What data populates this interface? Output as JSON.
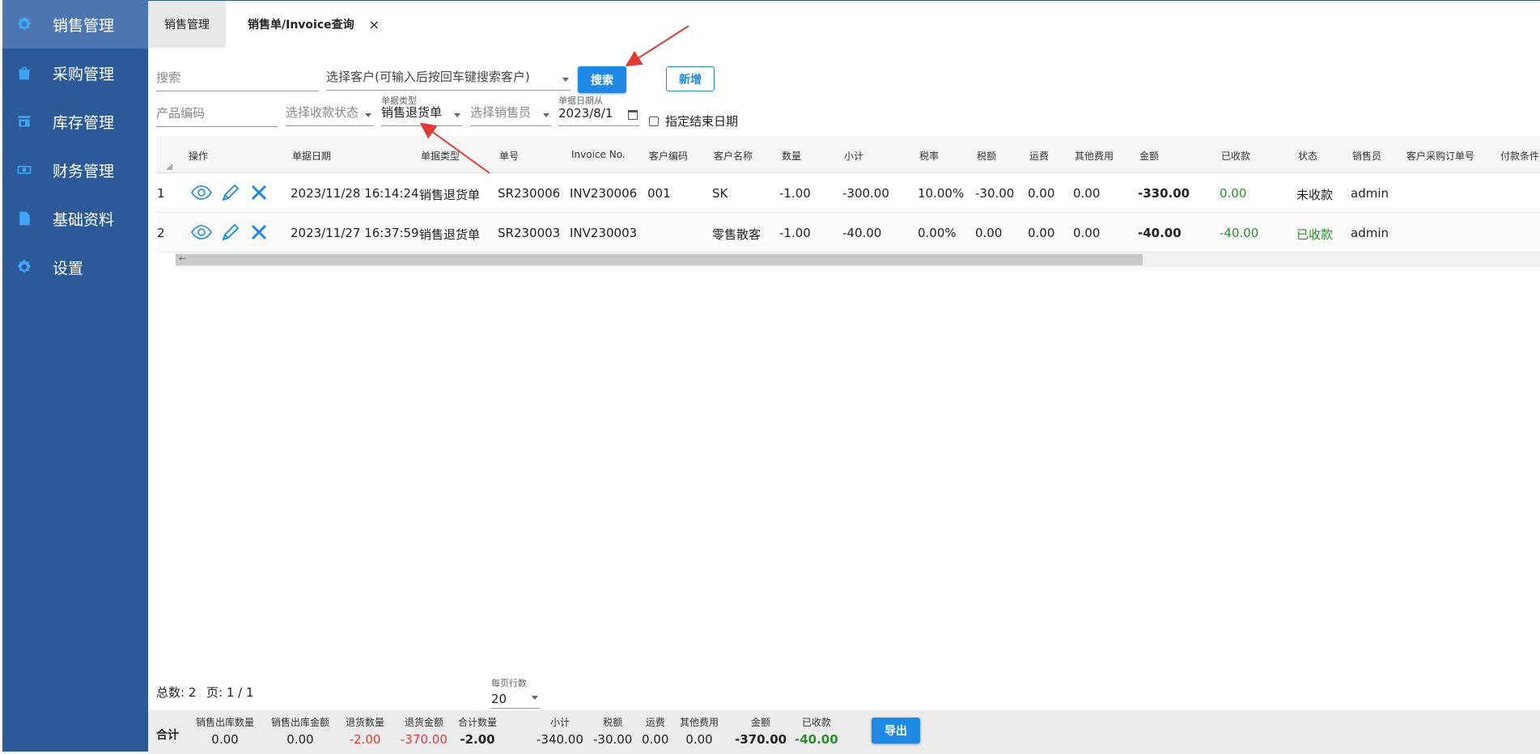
{
  "sidebar": {
    "items": [
      {
        "label": "销售管理",
        "icon": "gear-icon",
        "active": true
      },
      {
        "label": "采购管理",
        "icon": "shopping-bag-icon"
      },
      {
        "label": "库存管理",
        "icon": "store-icon"
      },
      {
        "label": "财务管理",
        "icon": "money-icon"
      },
      {
        "label": "基础资料",
        "icon": "document-icon"
      },
      {
        "label": "设置",
        "icon": "settings-icon"
      }
    ]
  },
  "tabs": [
    {
      "label": "销售管理"
    },
    {
      "label": "销售单/Invoice查询",
      "close": "×"
    }
  ],
  "filters": {
    "search_placeholder": "搜索",
    "customer_placeholder": "选择客户(可输入后按回车键搜索客户)",
    "search_button": "搜索",
    "add_button": "新增",
    "product_code_placeholder": "产品编码",
    "payment_status_placeholder": "选择收款状态",
    "doc_type_label": "单据类型",
    "doc_type_value": "销售退货单",
    "salesperson_placeholder": "选择销售员",
    "date_from_label": "单据日期从",
    "date_from_value": "2023/8/1",
    "end_date_checkbox": "指定结束日期"
  },
  "table": {
    "headers": [
      "操作",
      "单据日期",
      "单据类型",
      "单号",
      "Invoice No.",
      "客户编码",
      "客户名称",
      "数量",
      "小计",
      "税率",
      "税额",
      "运费",
      "其他费用",
      "金额",
      "已收款",
      "状态",
      "销售员",
      "客户采购订单号",
      "付款条件"
    ],
    "rows": [
      {
        "idx": "1",
        "date": "2023/11/28 16:14:24",
        "type": "销售退货单",
        "no": "SR230006",
        "invoice": "INV230006",
        "cust_code": "001",
        "cust_name": "SK",
        "qty": "-1.00",
        "subtotal": "-300.00",
        "tax_rate": "10.00%",
        "tax": "-30.00",
        "freight": "0.00",
        "other": "0.00",
        "amount": "-330.00",
        "received": "0.00",
        "status": "未收款",
        "sales": "admin"
      },
      {
        "idx": "2",
        "date": "2023/11/27 16:37:59",
        "type": "销售退货单",
        "no": "SR230003",
        "invoice": "INV230003",
        "cust_code": "",
        "cust_name": "零售散客",
        "qty": "-1.00",
        "subtotal": "-40.00",
        "tax_rate": "0.00%",
        "tax": "0.00",
        "freight": "0.00",
        "other": "0.00",
        "amount": "-40.00",
        "received": "-40.00",
        "status": "已收款",
        "sales": "admin"
      }
    ],
    "scroll_arrow": "←"
  },
  "pager": {
    "total": "总数: 2",
    "page": "页: 1 / 1",
    "rows_label": "每页行数",
    "rows_value": "20"
  },
  "footer": {
    "total_label": "合计",
    "items": [
      {
        "label": "销售出库数量",
        "value": "0.00"
      },
      {
        "label": "销售出库金额",
        "value": "0.00"
      },
      {
        "label": "退货数量",
        "value": "-2.00"
      },
      {
        "label": "退货金额",
        "value": "-370.00"
      },
      {
        "label": "合计数量",
        "value": "-2.00"
      },
      {
        "label": "小计",
        "value": "-340.00"
      },
      {
        "label": "税额",
        "value": "-30.00"
      },
      {
        "label": "运费",
        "value": "0.00"
      },
      {
        "label": "其他费用",
        "value": "0.00"
      },
      {
        "label": "金额",
        "value": "-370.00"
      },
      {
        "label": "已收款",
        "value": "-40.00"
      }
    ],
    "export_button": "导出"
  },
  "colors": {
    "sidebar": "#2c5a98",
    "accent": "#1e88e5",
    "green": "#2e8b2e",
    "red": "#e53935",
    "annotation": "#e53935"
  }
}
